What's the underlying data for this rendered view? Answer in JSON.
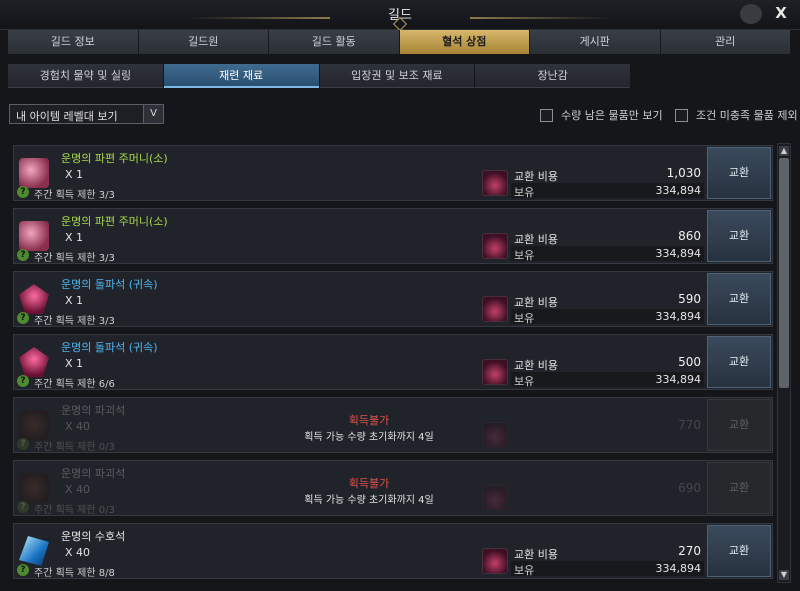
{
  "window": {
    "title": "길드",
    "close_label": "X"
  },
  "main_tabs": [
    {
      "label": "길드 정보",
      "active": false
    },
    {
      "label": "길드원",
      "active": false
    },
    {
      "label": "길드 활동",
      "active": false
    },
    {
      "label": "혈석 상점",
      "active": true
    },
    {
      "label": "게시판",
      "active": false
    },
    {
      "label": "관리",
      "active": false
    }
  ],
  "sub_tabs": [
    {
      "label": "경험치 물약 및 실링",
      "active": false
    },
    {
      "label": "재련 재료",
      "active": true
    },
    {
      "label": "입장권 및 보조 재료",
      "active": false
    },
    {
      "label": "장난감",
      "active": false
    }
  ],
  "filter": {
    "selected": "내 아이템 레벨대 보기",
    "arrow": "V"
  },
  "checkboxes": {
    "remaining_only": "수량 남은 물품만 보기",
    "exclude_unmet": "조건 미충족 물품 제외"
  },
  "labels": {
    "cost": "교환 비용",
    "owned": "보유",
    "exchange": "교환",
    "limit_icon": "?"
  },
  "items": [
    {
      "name": "운명의 파편 주머니(소)",
      "name_color": "green",
      "icon": "pouch-icon",
      "qty": "X 1",
      "limit": "주간 획득 제한 3/3",
      "cost": "1,030",
      "owned": "334,894",
      "available": true
    },
    {
      "name": "운명의 파편 주머니(소)",
      "name_color": "green",
      "icon": "pouch-icon",
      "qty": "X 1",
      "limit": "주간 획득 제한 3/3",
      "cost": "860",
      "owned": "334,894",
      "available": true
    },
    {
      "name": "운명의 돌파석 (귀속)",
      "name_color": "blue",
      "icon": "breakthrough-stone-icon",
      "qty": "X 1",
      "limit": "주간 획득 제한 3/3",
      "cost": "590",
      "owned": "334,894",
      "available": true
    },
    {
      "name": "운명의 돌파석 (귀속)",
      "name_color": "blue",
      "icon": "breakthrough-stone-icon",
      "qty": "X 1",
      "limit": "주간 획득 제한 6/6",
      "cost": "500",
      "owned": "334,894",
      "available": true
    },
    {
      "name": "운명의 파괴석",
      "name_color": "dim",
      "icon": "destruction-stone-icon",
      "qty": "X 40",
      "limit": "주간 획득 제한 0/3",
      "cost": "770",
      "owned": "",
      "available": false,
      "unavailable_title": "획득불가",
      "unavailable_sub": "획득 가능 수량 초기화까지 4일"
    },
    {
      "name": "운명의 파괴석",
      "name_color": "dim",
      "icon": "destruction-stone-icon",
      "qty": "X 40",
      "limit": "주간 획득 제한 0/3",
      "cost": "690",
      "owned": "",
      "available": false,
      "unavailable_title": "획득불가",
      "unavailable_sub": "획득 가능 수량 초기화까지 4일"
    },
    {
      "name": "운명의 수호석",
      "name_color": "white",
      "icon": "guardian-stone-icon",
      "qty": "X 40",
      "limit": "주간 획득 제한 8/8",
      "cost": "270",
      "owned": "334,894",
      "available": true
    }
  ],
  "colors": {
    "accent_gold": "#c9a552",
    "active_blue": "#3f6b8f",
    "unavailable_red": "#e0534a"
  }
}
